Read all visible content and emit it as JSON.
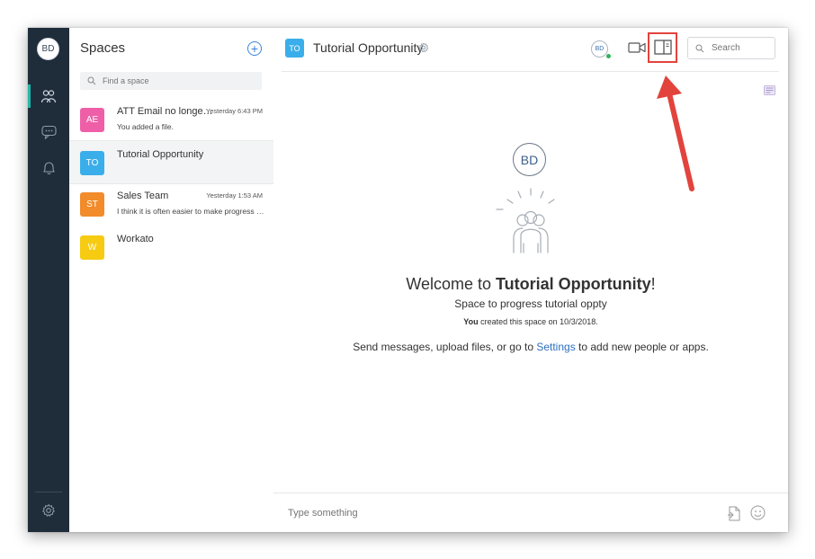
{
  "rail": {
    "avatar_initials": "BD",
    "items": [
      {
        "icon": "people-icon",
        "active": true
      },
      {
        "icon": "chat-icon",
        "active": false
      },
      {
        "icon": "bell-icon",
        "active": false
      }
    ],
    "settings_icon": "gear-icon"
  },
  "spaces": {
    "title": "Spaces",
    "add_icon": "plus-circle-icon",
    "search_placeholder": "Find a space",
    "items": [
      {
        "initials": "AE",
        "name": "ATT Email no longe…",
        "time": "Yesterday 6:43 PM",
        "preview": "You added a file.",
        "color": "#ef5fa8"
      },
      {
        "initials": "TO",
        "name": "Tutorial Opportunity",
        "time": "",
        "preview": "",
        "color": "#3aaeea"
      },
      {
        "initials": "ST",
        "name": "Sales Team",
        "time": "Yesterday 1:53 AM",
        "preview": "I think it is often easier to make progress …",
        "color": "#f28b2a"
      },
      {
        "initials": "W",
        "name": "Workato",
        "time": "",
        "preview": "",
        "color": "#f6cb12"
      }
    ]
  },
  "header": {
    "space_initials": "TO",
    "title": "Tutorial Opportunity",
    "participant_initials": "BD",
    "search_placeholder": "Search"
  },
  "welcome": {
    "avatar_initials": "BD",
    "prefix": "Welcome to ",
    "space_name": "Tutorial Opportunity",
    "suffix": "!",
    "description": "Space to progress tutorial oppty",
    "created_by": "You",
    "created_text": " created this space on 10/3/2018.",
    "instructions_prefix": "Send messages, upload files, or go to ",
    "settings_link": "Settings",
    "instructions_suffix": " to add new people or apps."
  },
  "composer": {
    "placeholder": "Type something"
  },
  "colors": {
    "rail_bg": "#1f2d3b",
    "accent": "#22b7a9",
    "link": "#2c6fc0",
    "annotation": "#e2433d"
  }
}
